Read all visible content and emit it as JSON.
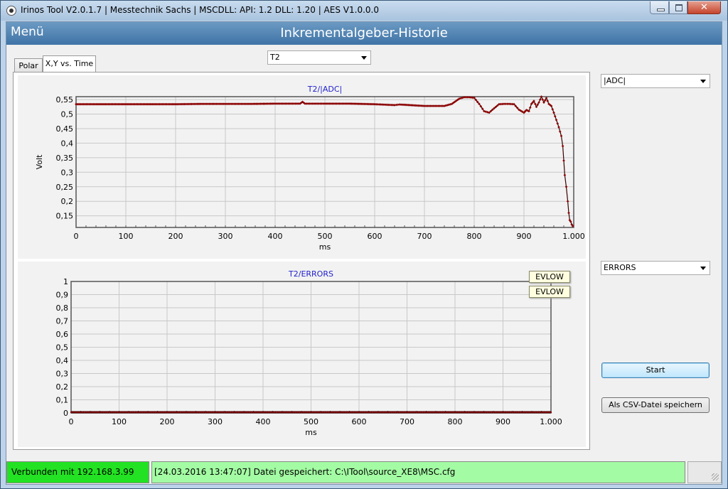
{
  "window": {
    "title": "Irinos Tool V2.0.1.7 | Messtechnik Sachs | MSCDLL: API: 1.2 DLL: 1.20 | AES V1.0.0.0",
    "close_glyph": "✕"
  },
  "header": {
    "menu_label": "Menü",
    "page_title": "Inkrementalgeber-Historie"
  },
  "tabs": [
    {
      "label": "Polar"
    },
    {
      "label": "X,Y vs. Time"
    }
  ],
  "channel_select": {
    "value": "T2"
  },
  "upper_select": {
    "value": "|ADC|"
  },
  "lower_select": {
    "value": "ERRORS"
  },
  "buttons": {
    "start": "Start",
    "csv": "Als CSV-Datei speichern"
  },
  "legend": {
    "item1": "EVLOW",
    "item2": "EVLOW"
  },
  "status": {
    "connection": "Verbunden mit 192.168.3.99",
    "message": "[24.03.2016 13:47:07] Datei gespeichert: C:\\ITool\\source_XE8\\MSC.cfg"
  },
  "colors": {
    "header_top": "#6b9ac3",
    "header_bottom": "#3f73a6",
    "chart_title": "#1f1fcc",
    "series_marker": "#8b0000",
    "status_connected": "#23e223",
    "status_message": "#a3fca3"
  },
  "chart_data": [
    {
      "type": "scatter",
      "title": "T2/|ADC|",
      "xlabel": "ms",
      "ylabel": "Volt",
      "xlim": [
        0,
        1000
      ],
      "ylim": [
        0.11,
        0.56
      ],
      "xticks": [
        "0",
        "100",
        "200",
        "300",
        "400",
        "500",
        "600",
        "700",
        "800",
        "900",
        "1.000"
      ],
      "yticks": [
        "0,15",
        "0,2",
        "0,25",
        "0,3",
        "0,35",
        "0,4",
        "0,45",
        "0,5",
        "0,55"
      ],
      "ytick_values": [
        0.15,
        0.2,
        0.25,
        0.3,
        0.35,
        0.4,
        0.45,
        0.5,
        0.55
      ],
      "grid": true,
      "series": [
        {
          "x": [
            0,
            50,
            100,
            150,
            200,
            250,
            300,
            350,
            400,
            450,
            455,
            460,
            500,
            550,
            600,
            640,
            650,
            700,
            740,
            755,
            770,
            780,
            790,
            800,
            810,
            820,
            830,
            840,
            850,
            860,
            870,
            880,
            890,
            900,
            905,
            910,
            915,
            920,
            925,
            930,
            935,
            940,
            945,
            950,
            955,
            960,
            965,
            970,
            975,
            978,
            980,
            982,
            985,
            988,
            990,
            992,
            994,
            996,
            998
          ],
          "y": [
            0.534,
            0.534,
            0.534,
            0.534,
            0.534,
            0.535,
            0.535,
            0.535,
            0.536,
            0.536,
            0.542,
            0.536,
            0.536,
            0.536,
            0.534,
            0.531,
            0.533,
            0.528,
            0.528,
            0.535,
            0.553,
            0.558,
            0.558,
            0.556,
            0.535,
            0.51,
            0.505,
            0.52,
            0.534,
            0.535,
            0.535,
            0.534,
            0.515,
            0.505,
            0.514,
            0.51,
            0.535,
            0.545,
            0.525,
            0.54,
            0.56,
            0.54,
            0.555,
            0.535,
            0.528,
            0.505,
            0.48,
            0.455,
            0.425,
            0.39,
            0.34,
            0.29,
            0.25,
            0.2,
            0.16,
            0.135,
            0.13,
            0.12,
            0.115
          ]
        }
      ]
    },
    {
      "type": "scatter",
      "title": "T2/ERRORS",
      "xlabel": "ms",
      "ylabel": "",
      "xlim": [
        0,
        1000
      ],
      "ylim": [
        0,
        1
      ],
      "xticks": [
        "0",
        "100",
        "200",
        "300",
        "400",
        "500",
        "600",
        "700",
        "800",
        "900",
        "1.000"
      ],
      "yticks": [
        "0",
        "0,1",
        "0,2",
        "0,3",
        "0,4",
        "0,5",
        "0,6",
        "0,7",
        "0,8",
        "0,9",
        "1"
      ],
      "ytick_values": [
        0,
        0.1,
        0.2,
        0.3,
        0.4,
        0.5,
        0.6,
        0.7,
        0.8,
        0.9,
        1
      ],
      "grid": true,
      "legend": [
        "EVLOW",
        "EVLOW"
      ],
      "legend_position": "top-right",
      "series": [
        {
          "x": [
            0,
            1000
          ],
          "y": [
            0,
            0
          ]
        }
      ]
    }
  ]
}
